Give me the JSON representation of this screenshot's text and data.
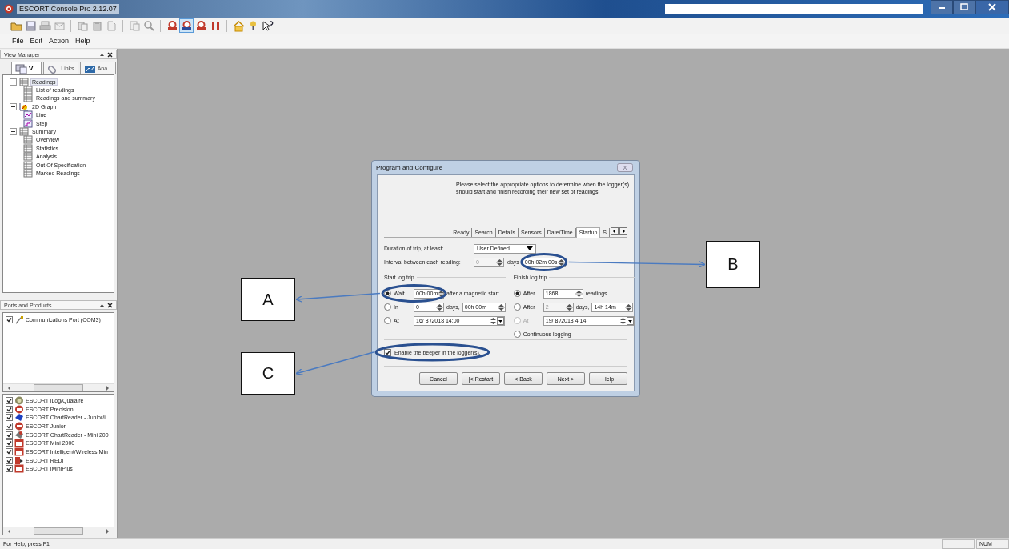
{
  "window": {
    "title": "ESCORT Console Pro 2.12.07"
  },
  "menu": [
    "File",
    "Edit",
    "Action",
    "Help"
  ],
  "view_manager": {
    "title": "View Manager",
    "tabs": [
      {
        "label": "V...",
        "selected": true
      },
      {
        "label": "Links",
        "selected": false
      },
      {
        "label": "Ana...",
        "selected": false
      }
    ],
    "tree": [
      {
        "label": "Readings",
        "kind": "table",
        "expanded": true,
        "selected": true,
        "children": [
          {
            "label": "List of readings",
            "kind": "table",
            "selected": false
          },
          {
            "label": "Readings and summary",
            "kind": "table",
            "selected": false
          }
        ]
      },
      {
        "label": "2D Graph",
        "kind": "graph",
        "expanded": true,
        "selected": false,
        "children": [
          {
            "label": "Line",
            "kind": "line",
            "selected": false
          },
          {
            "label": "Step",
            "kind": "step",
            "selected": false
          }
        ]
      },
      {
        "label": "Summary",
        "kind": "table",
        "expanded": true,
        "selected": false,
        "children": [
          {
            "label": "Overview",
            "kind": "table",
            "selected": false
          },
          {
            "label": "Statistics",
            "kind": "table",
            "selected": false
          },
          {
            "label": "Analysis",
            "kind": "table",
            "selected": false
          },
          {
            "label": "Out Of Specification",
            "kind": "table",
            "selected": false
          },
          {
            "label": "Marked Readings",
            "kind": "table",
            "selected": false
          }
        ]
      }
    ]
  },
  "ports_and_products": {
    "title": "Ports and Products",
    "ports": [
      {
        "label": "Communications Port (COM3)",
        "checked": true
      }
    ],
    "products": [
      {
        "label": "ESCORT iLog/Qualaire",
        "checked": true,
        "kind": "gauge"
      },
      {
        "label": "ESCORT Precision",
        "checked": true,
        "kind": "red-gauge"
      },
      {
        "label": "ESCORT ChartReader - Junior/iL",
        "checked": true,
        "kind": "blue-reader"
      },
      {
        "label": "ESCORT Junior",
        "checked": true,
        "kind": "red-gauge"
      },
      {
        "label": "ESCORT ChartReader - Mini 200",
        "checked": true,
        "kind": "grey-reader"
      },
      {
        "label": "ESCORT Mini 2000",
        "checked": true,
        "kind": "red-box"
      },
      {
        "label": "ESCORT Intelligent/Wireless Min",
        "checked": true,
        "kind": "red-box"
      },
      {
        "label": "ESCORT REDi",
        "checked": true,
        "kind": "red-flag"
      },
      {
        "label": "ESCORT iMiniPlus",
        "checked": true,
        "kind": "red-box"
      }
    ]
  },
  "dialog": {
    "title": "Program and Configure",
    "intro": "Please select the appropriate options to determine when the logger(s) should start and finish recording their new set of readings.",
    "tabs": [
      {
        "label": "Ready",
        "selected": false
      },
      {
        "label": "Search",
        "selected": false
      },
      {
        "label": "Details",
        "selected": false
      },
      {
        "label": "Sensors",
        "selected": false
      },
      {
        "label": "Date/Time",
        "selected": false
      },
      {
        "label": "Startup",
        "selected": true
      },
      {
        "label": "S",
        "selected": false
      }
    ],
    "duration": {
      "label": "Duration of trip, at least:",
      "value": "User Defined"
    },
    "interval": {
      "label": "Interval between each reading:",
      "days": "0",
      "days_label": "days",
      "time": "00h 02m 00s",
      "disabled": true
    },
    "start": {
      "label": "Start log trip",
      "options": [
        {
          "label": "Wait",
          "selected": true,
          "kind": "wait",
          "value": "00h 00m",
          "suffix": "after a magnetic start"
        },
        {
          "label": "In",
          "selected": false,
          "kind": "in",
          "value": "0",
          "suffix": "days,",
          "time": "00h 00m"
        },
        {
          "label": "At",
          "selected": false,
          "kind": "at",
          "value": "16/ 8 /2018  14:00"
        }
      ]
    },
    "finish": {
      "label": "Finish log trip",
      "options": [
        {
          "label": "After",
          "selected": true,
          "disabled": false,
          "kind": "after",
          "value": "1868",
          "suffix": "readings."
        },
        {
          "label": "After",
          "selected": false,
          "disabled": false,
          "kind": "after-days",
          "value": "2",
          "suffix": "days,",
          "time": "14h 14m"
        },
        {
          "label": "At",
          "selected": false,
          "disabled": true,
          "kind": "at",
          "value": "19/ 8 /2018   4:14"
        },
        {
          "label": "Continuous logging",
          "selected": false,
          "disabled": false,
          "kind": "plain"
        }
      ]
    },
    "beeper": {
      "label": "Enable the beeper in the logger(s).",
      "checked": true
    },
    "buttons": [
      "Cancel",
      "|< Restart",
      "< Back",
      "Next >",
      "Help"
    ]
  },
  "annotations": [
    "A",
    "B",
    "C"
  ],
  "status_bar": {
    "text": "For Help, press F1",
    "indicators": [
      "NUM"
    ]
  }
}
